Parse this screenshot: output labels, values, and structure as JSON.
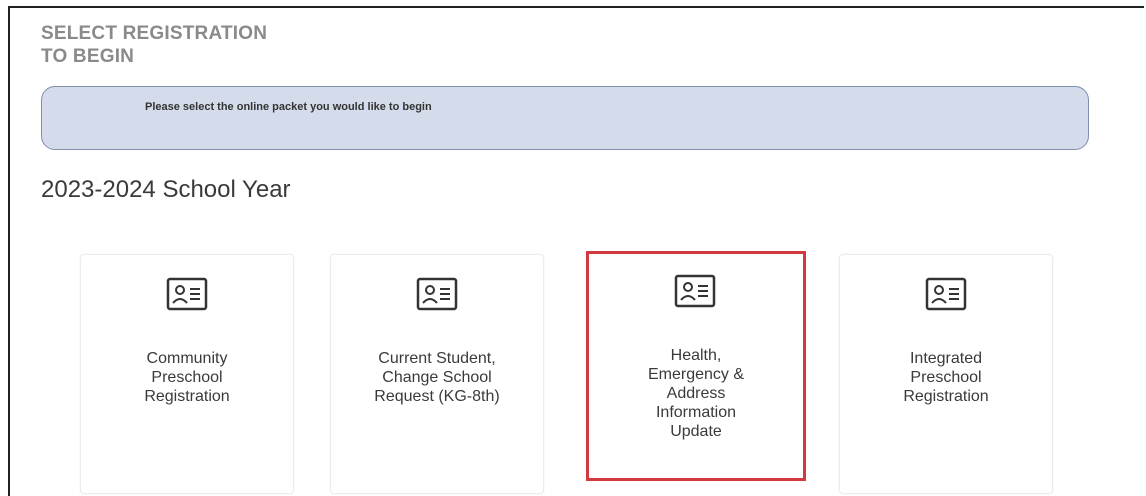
{
  "header": {
    "title_line1": "SELECT REGISTRATION",
    "title_line2": "TO BEGIN"
  },
  "notice": {
    "text": "Please select the online packet you would like to begin"
  },
  "school_year": {
    "heading": "2023-2024 School Year"
  },
  "cards": [
    {
      "icon": "id-card-icon",
      "lines": [
        "Community",
        "Preschool",
        "Registration"
      ]
    },
    {
      "icon": "id-card-icon",
      "lines": [
        "Current Student,",
        "Change School",
        "Request (KG-8th)"
      ]
    },
    {
      "icon": "id-card-icon",
      "lines": [
        "Health,",
        "Emergency &",
        "Address",
        "Information",
        "Update"
      ],
      "selected": true
    },
    {
      "icon": "id-card-icon",
      "lines": [
        "Integrated",
        "Preschool",
        "Registration"
      ]
    }
  ],
  "colors": {
    "highlight": "#d33a3f",
    "notice_bg": "#d4dceb",
    "notice_border": "#7f8fad",
    "title": "#8a8a8a"
  }
}
